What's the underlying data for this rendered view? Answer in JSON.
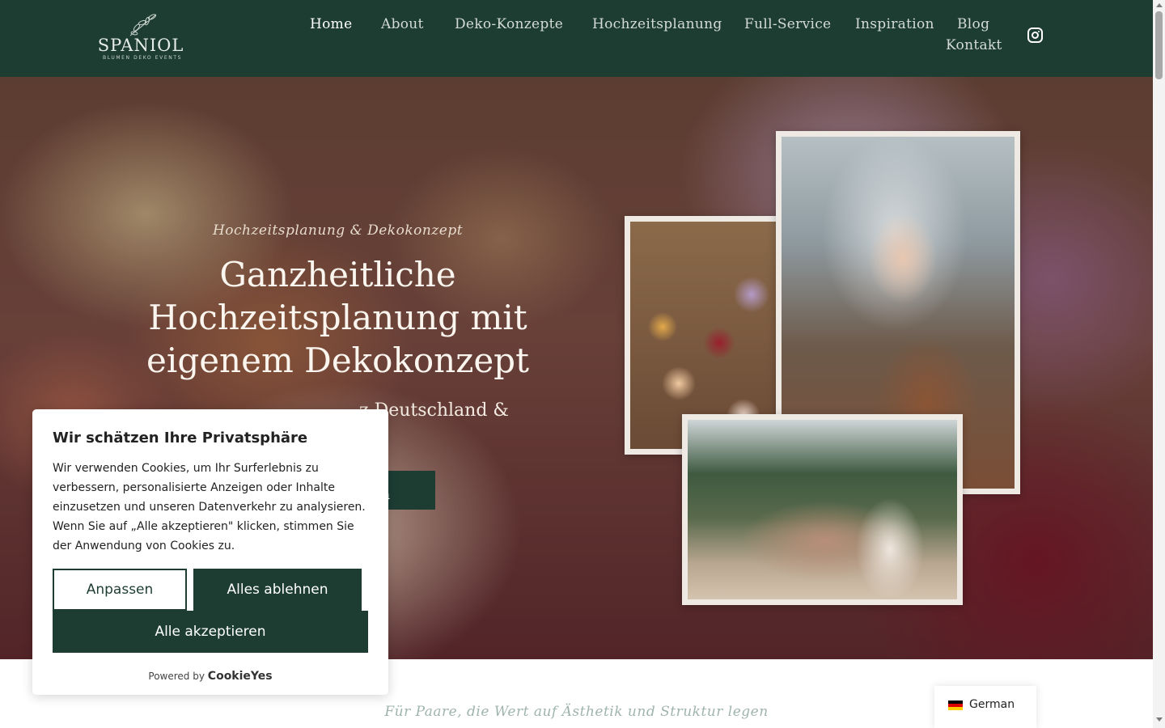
{
  "header": {
    "logo_text": "SPANIOL",
    "logo_subtext": "BLUMEN DEKO EVENTS",
    "nav": [
      {
        "label": "Home",
        "active": true
      },
      {
        "label": "About"
      },
      {
        "label": "Deko-Konzepte"
      },
      {
        "label": "Hochzeitsplanung"
      },
      {
        "label": "Full-Service"
      },
      {
        "label": "Inspiration"
      },
      {
        "label": "Blog"
      },
      {
        "label": "Kontakt"
      }
    ],
    "social_icon": "instagram-icon"
  },
  "hero": {
    "eyebrow": "Hochzeitsplanung & Dekokonzept",
    "title": "Ganzheitliche Hochzeitsplanung mit eigenem Dekokonzept",
    "subtitle_visible": "z Deutschland &",
    "cta_visible": "agen"
  },
  "tagline": "Für Paare, die Wert auf Ästhetik und Struktur legen",
  "language_switcher": {
    "label": "German",
    "flag": "germany-flag-icon"
  },
  "cookie_banner": {
    "title": "Wir schätzen Ihre Privatsphäre",
    "text": "Wir verwenden Cookies, um Ihr Surferlebnis zu verbessern, personalisierte Anzeigen oder Inhalte einzusetzen und unseren Datenverkehr zu analysieren. Wenn Sie auf „Alle akzeptieren\" klicken, stimmen Sie der Anwendung von Cookies zu.",
    "customize_label": "Anpassen",
    "reject_label": "Alles ablehnen",
    "accept_label": "Alle akzeptieren",
    "powered_by": "Powered by",
    "brand": "CookieYes"
  },
  "colors": {
    "brand_green": "#1d3d33",
    "tagline_green": "#9fb4ac"
  }
}
